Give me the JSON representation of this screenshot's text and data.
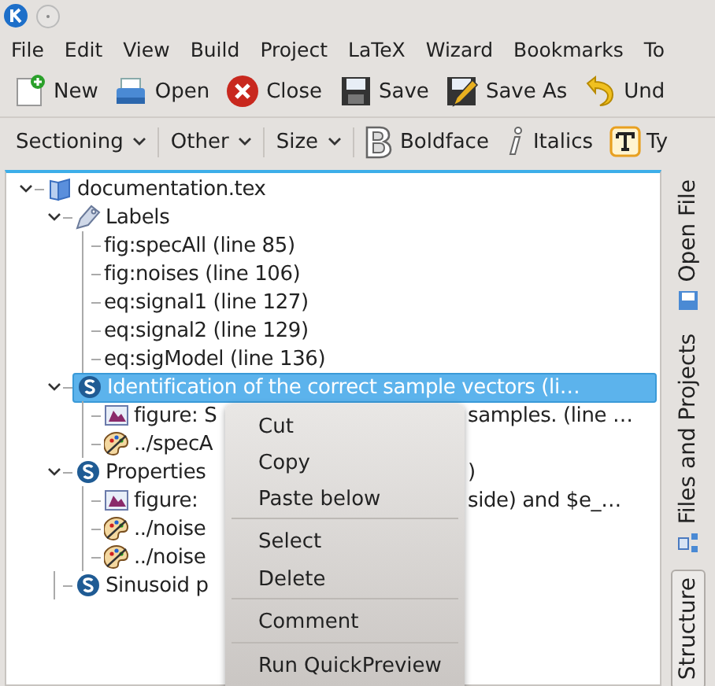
{
  "menu_bar": [
    "File",
    "Edit",
    "View",
    "Build",
    "Project",
    "LaTeX",
    "Wizard",
    "Bookmarks",
    "To"
  ],
  "main_toolbar": [
    {
      "label": "New",
      "kind": "new"
    },
    {
      "label": "Open",
      "kind": "open"
    },
    {
      "label": "Close",
      "kind": "close"
    },
    {
      "label": "Save",
      "kind": "save"
    },
    {
      "label": "Save As",
      "kind": "saveas"
    },
    {
      "label": "Und",
      "kind": "undo"
    }
  ],
  "latex_toolbar": [
    {
      "label": "Sectioning",
      "kind": "dropdown"
    },
    {
      "label": "Other",
      "kind": "dropdown"
    },
    {
      "label": "Size",
      "kind": "dropdown"
    },
    {
      "label": "Boldface",
      "kind": "bold"
    },
    {
      "label": "Italics",
      "kind": "italic"
    },
    {
      "label": "Ty",
      "kind": "typewriter"
    }
  ],
  "structure_tree": [
    {
      "text": "documentation.tex",
      "kind": "file",
      "selected": false,
      "children": [
        {
          "text": "Labels",
          "kind": "labels",
          "selected": false,
          "children": [
            {
              "text": "fig:specAll (line 85)",
              "kind": "label",
              "selected": false
            },
            {
              "text": "fig:noises (line 106)",
              "kind": "label",
              "selected": false
            },
            {
              "text": "eq:signal1 (line 127)",
              "kind": "label",
              "selected": false
            },
            {
              "text": "eq:signal2 (line 129)",
              "kind": "label",
              "selected": false
            },
            {
              "text": "eq:sigModel (line 136)",
              "kind": "label",
              "selected": false
            }
          ]
        },
        {
          "text": "Identification of the correct sample vectors (li…",
          "kind": "section",
          "selected": true,
          "children": [
            {
              "text": "figure: S",
              "tail": "samples. (line …",
              "kind": "figure",
              "selected": false
            },
            {
              "text": "../specA",
              "kind": "image",
              "selected": false
            }
          ]
        },
        {
          "text": "Properties",
          "tail": ")",
          "kind": "section",
          "selected": false,
          "children": [
            {
              "text": "figure:",
              "tail": "side) and $e_…",
              "kind": "figure",
              "selected": false
            },
            {
              "text": "../noise",
              "kind": "image",
              "selected": false
            },
            {
              "text": "../noise",
              "kind": "image",
              "selected": false
            }
          ]
        },
        {
          "text": "Sinusoid p",
          "kind": "section",
          "selected": false
        }
      ]
    }
  ],
  "side_tabs": [
    {
      "label": "Open File",
      "kind": "open",
      "selected": false
    },
    {
      "label": "Files and Projects",
      "kind": "projects",
      "selected": false
    },
    {
      "label": "Structure",
      "kind": "plain",
      "selected": true
    }
  ],
  "context_menu": [
    {
      "label": "Cut",
      "separator_before": false
    },
    {
      "label": "Copy",
      "separator_before": false
    },
    {
      "label": "Paste below",
      "separator_before": false
    },
    {
      "label": "Select",
      "separator_before": true
    },
    {
      "label": "Delete",
      "separator_before": false
    },
    {
      "label": "Comment",
      "separator_before": true
    },
    {
      "label": "Run QuickPreview",
      "separator_before": true
    }
  ]
}
